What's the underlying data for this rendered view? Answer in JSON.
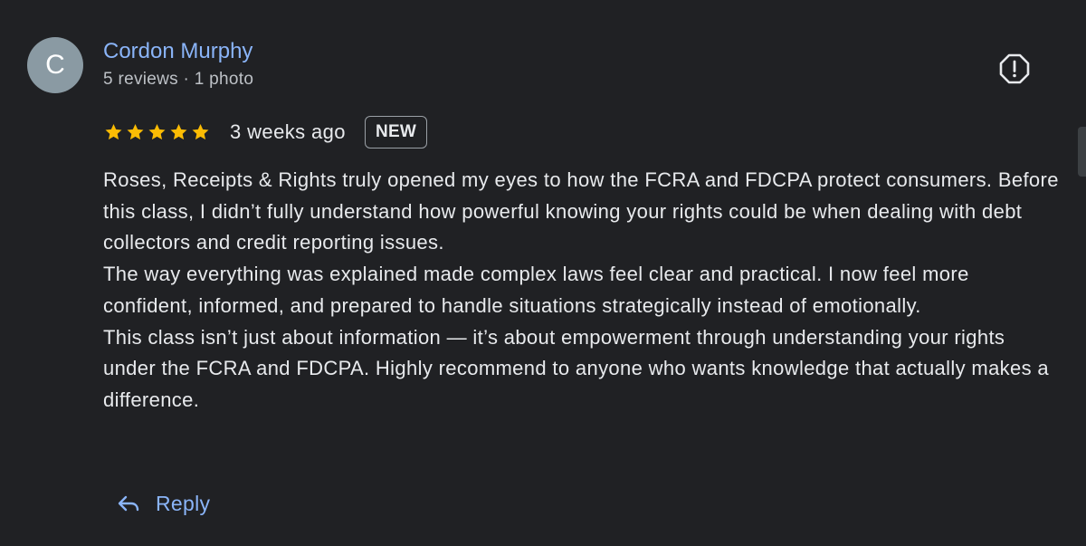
{
  "reviewer": {
    "avatar_letter": "C",
    "name": "Cordon Murphy",
    "meta": "5 reviews · 1 photo"
  },
  "review": {
    "rating": 5,
    "rating_max": 5,
    "date": "3 weeks ago",
    "badge": "NEW",
    "paragraphs": [
      "Roses, Receipts & Rights truly opened my eyes to how the FCRA and FDCPA protect consumers. Before this class, I didn’t fully understand how powerful knowing your rights could be when dealing with debt collectors and credit reporting issues.",
      "The way everything was explained made complex laws feel clear and practical. I now feel more confident, informed, and prepared to handle situations strategically instead of emotionally.",
      "This class isn’t just about information — it’s about empowerment through understanding your rights under the FCRA and FDCPA. Highly recommend to anyone who wants knowledge that actually makes a difference."
    ]
  },
  "actions": {
    "reply_label": "Reply",
    "report_icon": "report-octagon-icon",
    "reply_icon": "reply-arrow-icon"
  },
  "colors": {
    "background": "#202124",
    "link_blue": "#8ab4f8",
    "star_yellow": "#fbbc04",
    "text_primary": "#e8eaed",
    "text_secondary": "#bdc1c6",
    "avatar_bg": "#8a9aa3"
  }
}
